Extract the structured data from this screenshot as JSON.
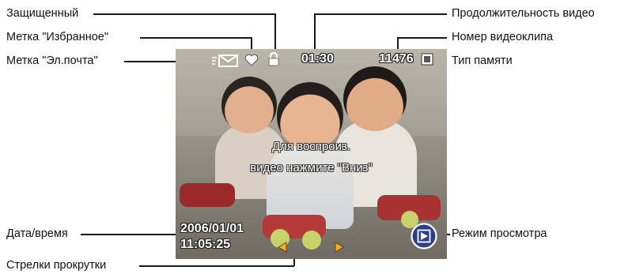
{
  "callouts": {
    "protected": "Защищенный",
    "favorite_tag": "Метка \"Избранное\"",
    "email_tag": "Метка \"Эл.почта\"",
    "video_length": "Продолжительность видео",
    "video_clip_number": "Номер видеоклипа",
    "memory_type": "Тип памяти",
    "date_time": "Дата/время",
    "scroll_arrows": "Стрелки прокрутки",
    "review_mode": "Режим просмотра"
  },
  "screen": {
    "duration": "01:30",
    "clip_number": "11476",
    "date": "2006/01/01",
    "time": "11:05:25",
    "message_line1": "Для воспроиз.",
    "message_line2": "видео нажмите \"Вниз\""
  },
  "icons": {
    "email": "envelope-icon",
    "favorite": "heart-icon",
    "protected": "lock-icon",
    "memory": "internal-memory-icon",
    "review": "play-icon",
    "scroll_left": "arrow-left-icon",
    "scroll_right": "arrow-right-icon"
  },
  "colors": {
    "osd_text": "#ffffff",
    "arrows": "#f2b022",
    "leader_lines": "#1a1a1a"
  }
}
